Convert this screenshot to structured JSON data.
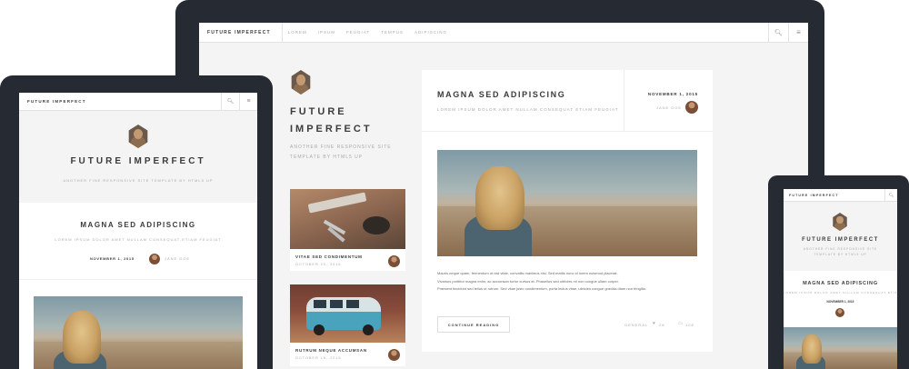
{
  "site": {
    "brand": "FUTURE IMPERFECT",
    "nav_links": [
      "LOREM",
      "IPSUM",
      "FEUGIAT",
      "TEMPUS",
      "ADIPISCING"
    ],
    "icons": {
      "search": "search-icon",
      "menu": "menu-icon"
    },
    "title_line1": "FUTURE",
    "title_line2": "IMPERFECT",
    "tagline_line1": "ANOTHER FINE RESPONSIVE SITE",
    "tagline_line2": "TEMPLATE BY HTML5 UP",
    "tagline_full": "ANOTHER FINE RESPONSIVE SITE TEMPLATE BY HTML5 UP"
  },
  "post": {
    "title": "MAGNA SED ADIPISCING",
    "subtitle": "LOREM IPSUM DOLOR AMET NULLAM CONSEQUAT ETIAM FEUGIAT",
    "date": "NOVEMBER 1, 2015",
    "author": "JANE DOE",
    "body_lines": [
      "Mauris neque quam, fermentum ut nisl vitae, convallis maximus nisl. Sed mattis nunc id lorem euismod placerat.",
      "Vivamus porttitor magna enim, ac accumsan tortor cursus at. Phasellus sed ultricies mi non congue ullam corper.",
      "Praesent tincidunt sed tellus ut rutrum. Sed vitae justo condimentum, porta lectus vitae, ultricies congue gravida diam non fringilla."
    ],
    "continue_label": "CONTINUE READING",
    "category": "GENERAL",
    "likes": "28",
    "comments": "128"
  },
  "mini_posts": [
    {
      "title": "VITAE SED CONDIMENTUM",
      "date": "OCTOBER 20, 2015"
    },
    {
      "title": "RUTRUM NEQUE ACCUMSAN",
      "date": "OCTOBER 19, 2015"
    }
  ],
  "colors": {
    "frame": "#262b33",
    "background": "#f4f4f4",
    "text": "#3c3b3b",
    "muted": "#aaaaaa",
    "van": "#4aa3bd"
  }
}
